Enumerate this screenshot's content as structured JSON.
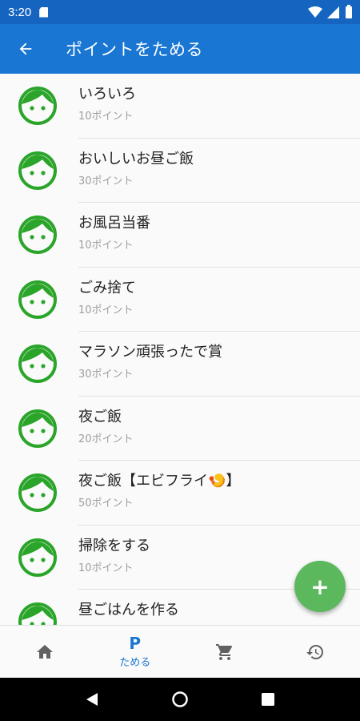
{
  "status_bar": {
    "time": "3:20"
  },
  "app_bar": {
    "title": "ポイントをためる"
  },
  "items": [
    {
      "name": "いろいろ",
      "points": "10ポイント"
    },
    {
      "name": "おいしいお昼ご飯",
      "points": "30ポイント"
    },
    {
      "name": "お風呂当番",
      "points": "10ポイント"
    },
    {
      "name": "ごみ捨て",
      "points": "10ポイント"
    },
    {
      "name": "マラソン頑張ったで賞",
      "points": "30ポイント"
    },
    {
      "name": "夜ご飯",
      "points": "20ポイント"
    },
    {
      "name": "夜ご飯【エビフライ🍤】",
      "points": "50ポイント"
    },
    {
      "name": "掃除をする",
      "points": "10ポイント"
    },
    {
      "name": "昼ごはんを作る",
      "points": ""
    }
  ],
  "fab": {
    "label": "+"
  },
  "bottom_nav": {
    "items": [
      {
        "icon": "home-icon",
        "label": ""
      },
      {
        "icon": "p-icon",
        "glyph": "P",
        "label": "ためる",
        "active": true
      },
      {
        "icon": "cart-icon",
        "label": ""
      },
      {
        "icon": "history-icon",
        "label": ""
      }
    ]
  },
  "colors": {
    "status_bar": "#1565c0",
    "app_bar": "#1976d2",
    "face": "#2aa52a",
    "fab": "#5cb85c",
    "active_nav": "#1976d2"
  }
}
